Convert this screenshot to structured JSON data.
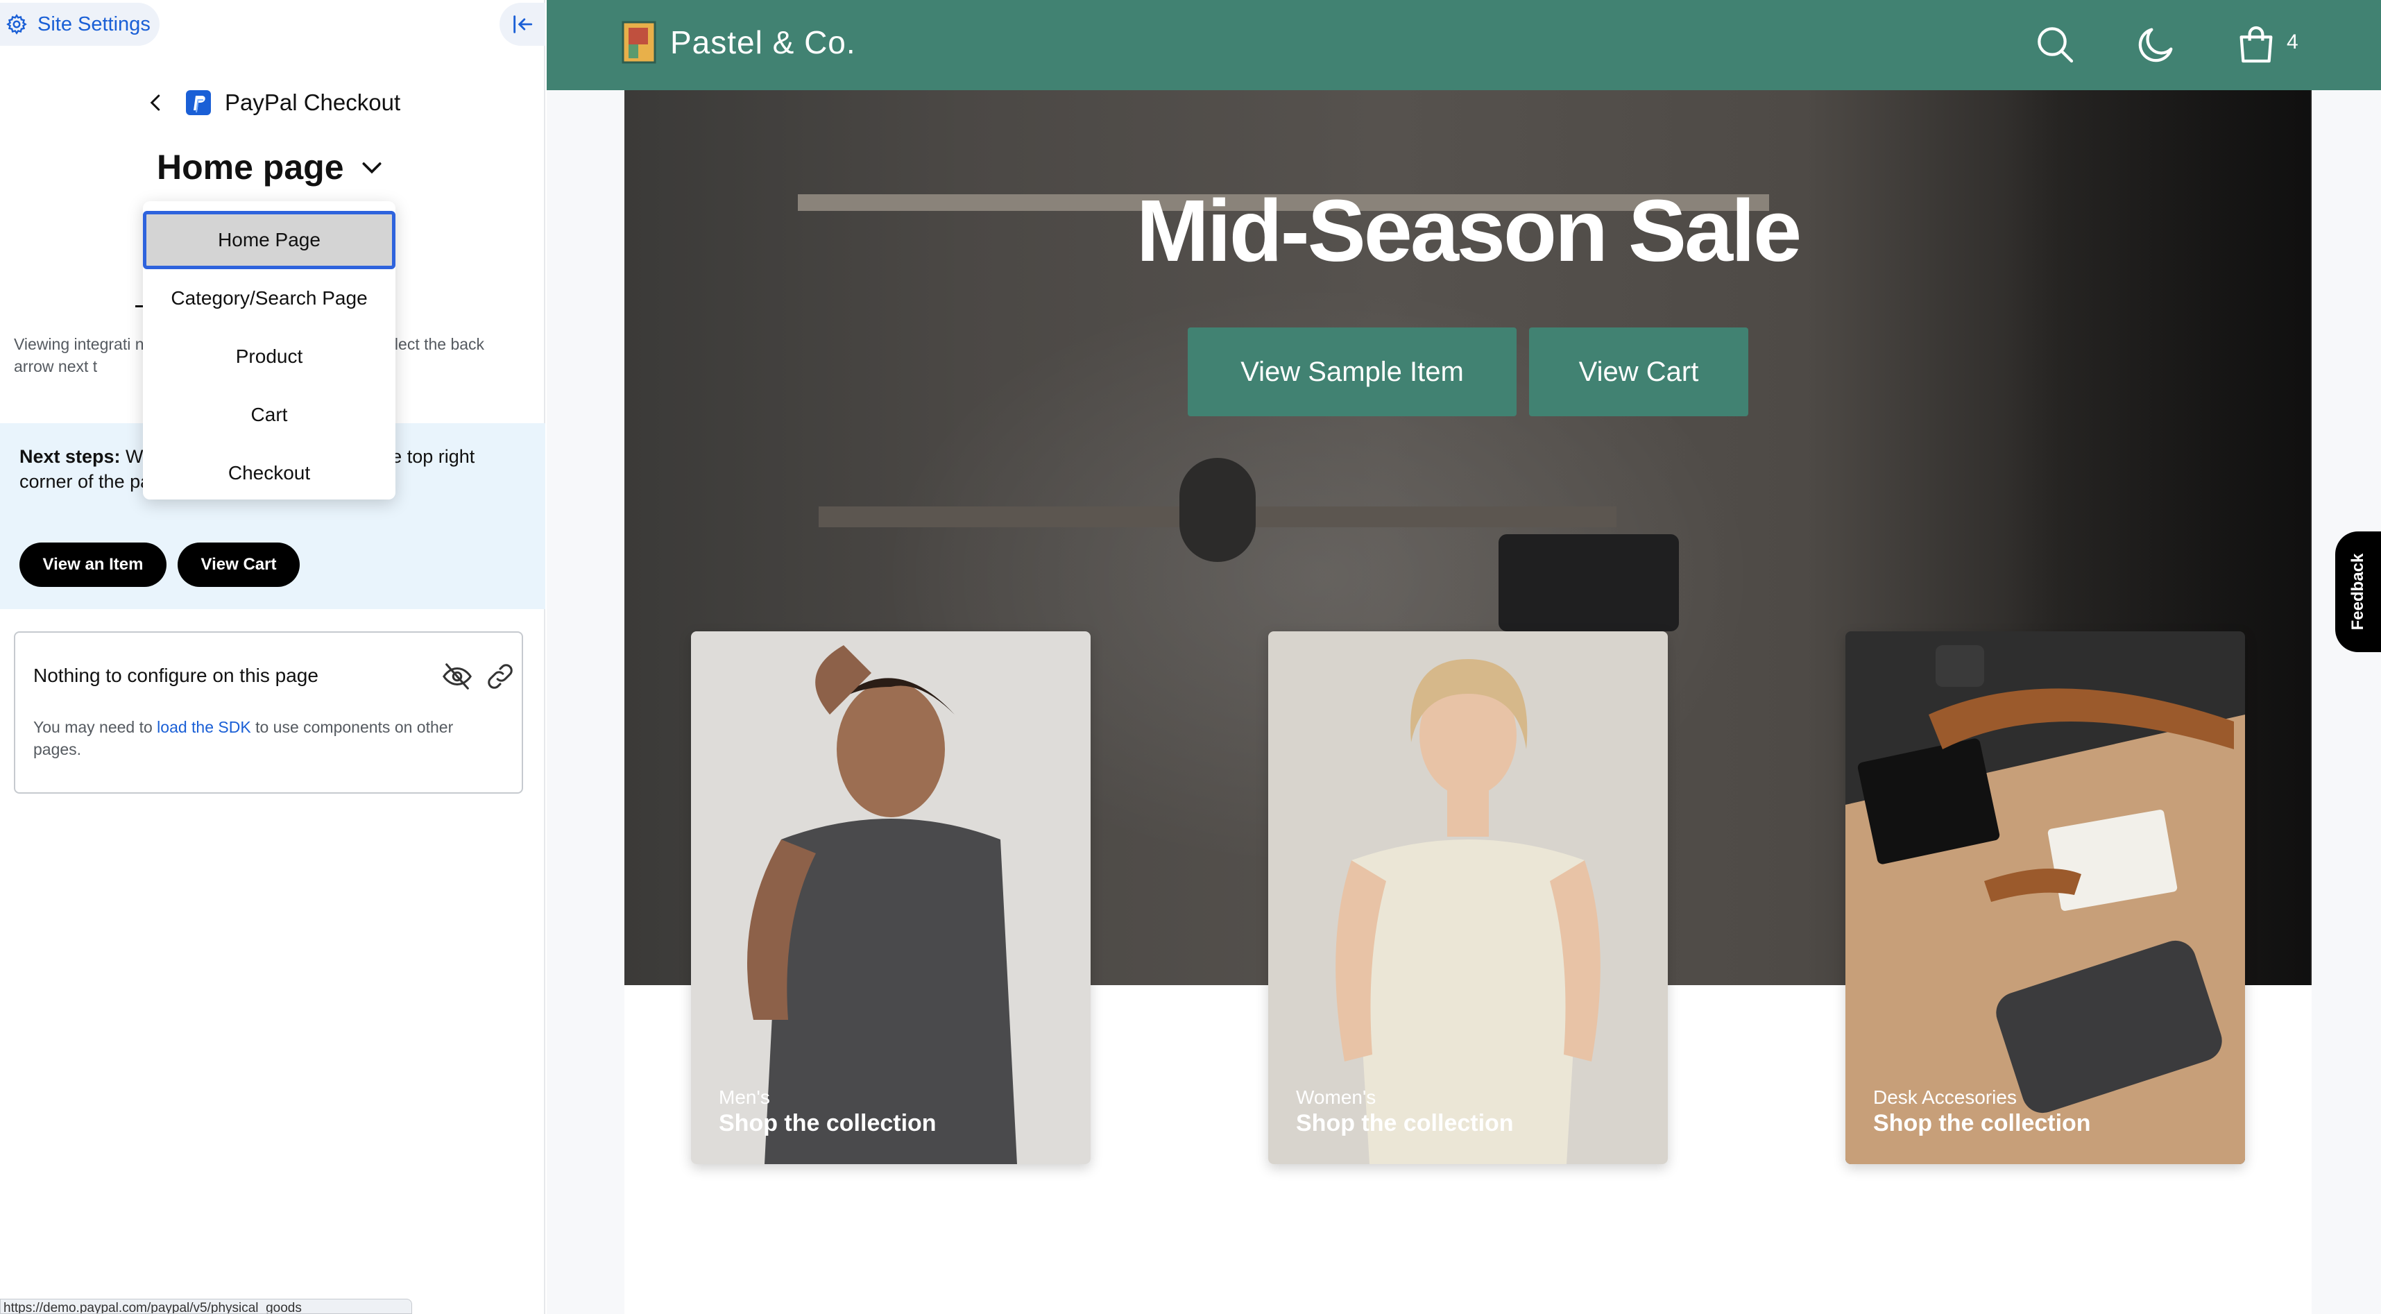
{
  "sidebar": {
    "site_settings_label": "Site Settings",
    "breadcrumb_label": "PayPal Checkout",
    "page_selector_label": "Home page",
    "viewing_text": "Viewing integrati                                 n the Home page. To see inte                              uct, select the back arrow next t",
    "next_steps_bold": "Next steps:",
    "next_steps_text": " We                                  he cart, click the “View Cart                          e top right corner of the pa",
    "view_item_label": "View an Item",
    "view_cart_label": "View Cart",
    "config_title": "Nothing to configure on this page",
    "config_desc_prefix": "You may need to ",
    "config_desc_link": "load the SDK",
    "config_desc_suffix": " to use components on other pages.",
    "status_url": "https://demo.paypal.com/paypal/v5/physical_goods",
    "dropdown_options": [
      "Home Page",
      "Category/Search Page",
      "Product",
      "Cart",
      "Checkout"
    ],
    "dropdown_selected": "Home Page"
  },
  "site": {
    "brand_name": "Pastel & Co.",
    "cart_count": "4",
    "hero_title": "Mid-Season Sale",
    "hero_sample_button": "View Sample Item",
    "hero_cart_button": "View Cart",
    "cards": [
      {
        "category": "Men's",
        "cta": "Shop the collection"
      },
      {
        "category": "Women's",
        "cta": "Shop the collection"
      },
      {
        "category": "Desk Accesories",
        "cta": "Shop the collection"
      }
    ],
    "feedback_label": "Feedback"
  },
  "colors": {
    "brand_green": "#418272",
    "link_blue": "#1a5fd6",
    "dropdown_focus": "#2e63dd",
    "next_steps_bg": "#e9f4fc"
  },
  "icons": [
    "gear-icon",
    "collapse-left-icon",
    "back-chevron-icon",
    "paypal-logo-icon",
    "chevron-down-icon",
    "eye-off-icon",
    "link-icon",
    "search-icon",
    "moon-icon",
    "shopping-bag-icon",
    "brand-logo-icon"
  ]
}
